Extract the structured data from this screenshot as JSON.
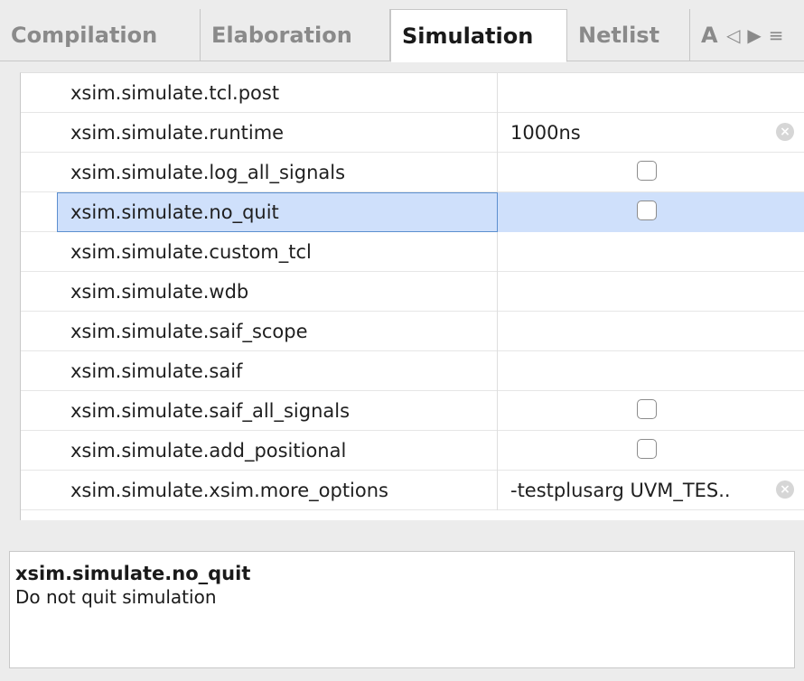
{
  "tabs": [
    {
      "label": "Compilation",
      "active": false
    },
    {
      "label": "Elaboration",
      "active": false
    },
    {
      "label": "Simulation",
      "active": true
    },
    {
      "label": "Netlist",
      "active": false
    },
    {
      "label": "A",
      "active": false
    }
  ],
  "tab_scroll": {
    "left": "◁",
    "right": "▶",
    "menu": "≡"
  },
  "properties": [
    {
      "name": "xsim.simulate.tcl.post",
      "value": "",
      "type": "text",
      "clearable": false,
      "selected": false
    },
    {
      "name": "xsim.simulate.runtime",
      "value": "1000ns",
      "type": "text",
      "clearable": true,
      "selected": false
    },
    {
      "name": "xsim.simulate.log_all_signals",
      "value": "",
      "type": "checkbox",
      "checked": false,
      "selected": false
    },
    {
      "name": "xsim.simulate.no_quit",
      "value": "",
      "type": "checkbox",
      "checked": false,
      "selected": true
    },
    {
      "name": "xsim.simulate.custom_tcl",
      "value": "",
      "type": "text",
      "clearable": false,
      "selected": false
    },
    {
      "name": "xsim.simulate.wdb",
      "value": "",
      "type": "text",
      "clearable": false,
      "selected": false
    },
    {
      "name": "xsim.simulate.saif_scope",
      "value": "",
      "type": "text",
      "clearable": false,
      "selected": false
    },
    {
      "name": "xsim.simulate.saif",
      "value": "",
      "type": "text",
      "clearable": false,
      "selected": false
    },
    {
      "name": "xsim.simulate.saif_all_signals",
      "value": "",
      "type": "checkbox",
      "checked": false,
      "selected": false
    },
    {
      "name": "xsim.simulate.add_positional",
      "value": "",
      "type": "checkbox",
      "checked": false,
      "selected": false
    },
    {
      "name": "xsim.simulate.xsim.more_options",
      "value": "-testplusarg UVM_TES..",
      "type": "text",
      "clearable": true,
      "selected": false
    }
  ],
  "description": {
    "title": "xsim.simulate.no_quit",
    "text": "Do not quit simulation"
  },
  "clear_glyph": "×"
}
